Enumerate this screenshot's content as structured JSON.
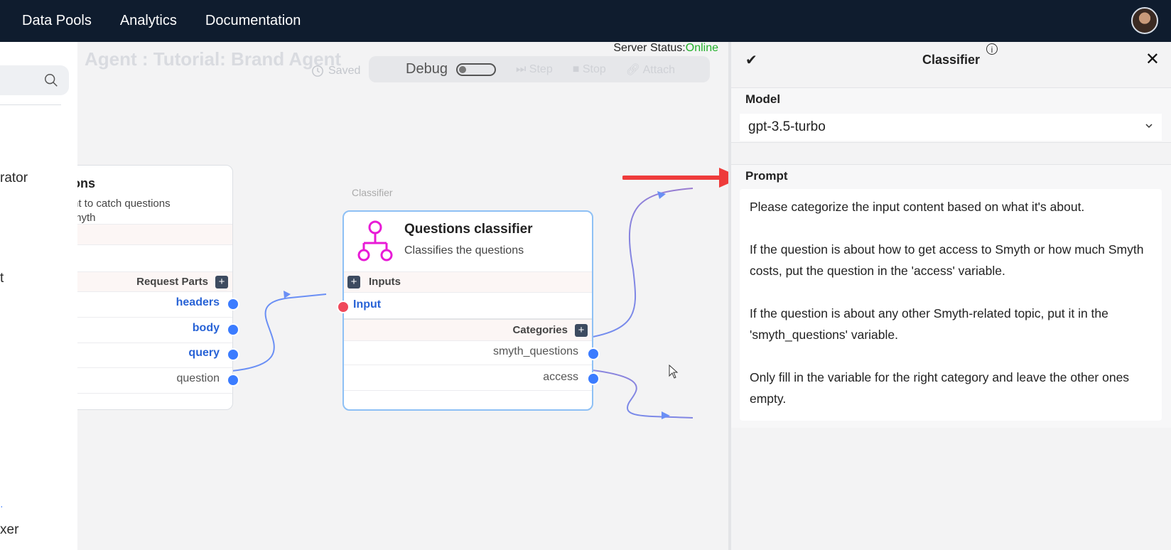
{
  "nav": {
    "items": [
      "Data Pools",
      "Analytics",
      "Documentation"
    ]
  },
  "sidebar": {
    "fragments": [
      "rator",
      "t",
      "xer"
    ]
  },
  "canvas": {
    "agent_title": "Agent : Tutorial: Brand Agent",
    "saved_label": "Saved",
    "debug": {
      "label": "Debug",
      "step": "Step",
      "stop": "Stop",
      "attach": "Attach"
    },
    "server_status": {
      "label": "Server Status:",
      "value": "Online",
      "color": "#22b02a"
    }
  },
  "left_node": {
    "title": "ons",
    "desc_line1": "nt to catch questions",
    "desc_line2": "myth",
    "section_label": "Request Parts",
    "outputs": [
      "headers",
      "body",
      "query",
      "question"
    ]
  },
  "classifier_node": {
    "type_label": "Classifier",
    "title": "Questions classifier",
    "desc": "Classifies the questions",
    "inputs_label": "Inputs",
    "input_port": "Input",
    "categories_label": "Categories",
    "outputs": [
      "smyth_questions",
      "access"
    ],
    "icon": "hierarchy-icon",
    "icon_color": "#e81ad6"
  },
  "panel": {
    "title": "Classifier",
    "model_label": "Model",
    "model_value": "gpt-3.5-turbo",
    "prompt_label": "Prompt",
    "prompt_paragraphs": [
      "Please categorize the input content based on what it's about.",
      "If the question is about how to get access to Smyth or how much Smyth costs, put the question in the 'access' variable.",
      "If the question is about any other Smyth-related topic, put it in the 'smyth_questions' variable.",
      "Only fill in the variable for the right category and leave the other ones empty."
    ]
  },
  "colors": {
    "nav_bg": "#0f1c2e",
    "port_blue": "#3b7cff",
    "port_red": "#f0485a",
    "arrow_red": "#ee3b3b"
  }
}
